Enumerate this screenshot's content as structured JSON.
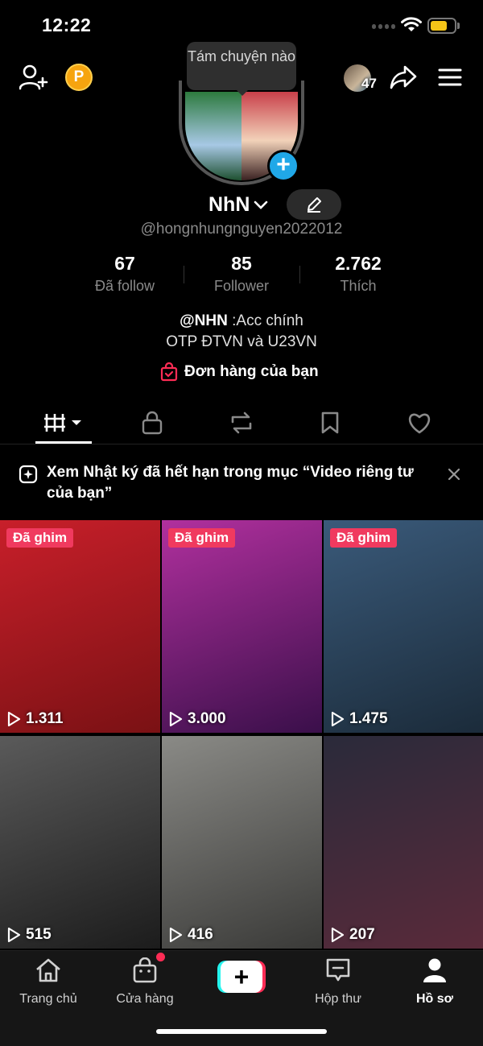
{
  "status_bar": {
    "time": "12:22",
    "battery_level": 0.7
  },
  "header": {
    "coin_label": "P",
    "friends_count": "47"
  },
  "tooltip": {
    "text": "Tám chuyện nào"
  },
  "profile": {
    "name": "NhN",
    "handle": "@hongnhungnguyen2022012",
    "stats": [
      {
        "value": "67",
        "label": "Đã follow"
      },
      {
        "value": "85",
        "label": "Follower"
      },
      {
        "value": "2.762",
        "label": "Thích"
      }
    ],
    "bio_mention": "@NHN",
    "bio_line1_rest": " :Acc chính",
    "bio_line2": "OTP ĐTVN và U23VN",
    "orders_label": "Đơn hàng của bạn"
  },
  "tabs": [
    {
      "icon": "grid-icon",
      "active": true
    },
    {
      "icon": "lock-icon"
    },
    {
      "icon": "repost-icon"
    },
    {
      "icon": "bookmark-icon"
    },
    {
      "icon": "heart-icon"
    }
  ],
  "notice": {
    "text": "Xem Nhật ký đã hết hạn trong mục “Video riêng tư của bạn”"
  },
  "videos": [
    {
      "pinned_label": "Đã ghim",
      "views": "1.311",
      "colors": [
        "#c81f2a",
        "#7a1114"
      ]
    },
    {
      "pinned_label": "Đã ghim",
      "views": "3.000",
      "colors": [
        "#b1309e",
        "#3a0f4a"
      ]
    },
    {
      "pinned_label": "Đã ghim",
      "views": "1.475",
      "colors": [
        "#3a5a7a",
        "#1b2b3a"
      ]
    },
    {
      "views": "515",
      "colors": [
        "#5a5a5a",
        "#1c1c1c"
      ]
    },
    {
      "views": "416",
      "colors": [
        "#8a8a86",
        "#3a3a38"
      ]
    },
    {
      "views": "207",
      "colors": [
        "#2a2a3a",
        "#5a2a3a"
      ]
    }
  ],
  "bottom_nav": [
    {
      "label": "Trang chủ",
      "icon": "home-icon"
    },
    {
      "label": "Cửa hàng",
      "icon": "shop-icon"
    },
    {
      "label": "",
      "icon": "create-icon"
    },
    {
      "label": "Hộp thư",
      "icon": "inbox-icon"
    },
    {
      "label": "Hồ sơ",
      "icon": "profile-icon",
      "active": true
    }
  ]
}
